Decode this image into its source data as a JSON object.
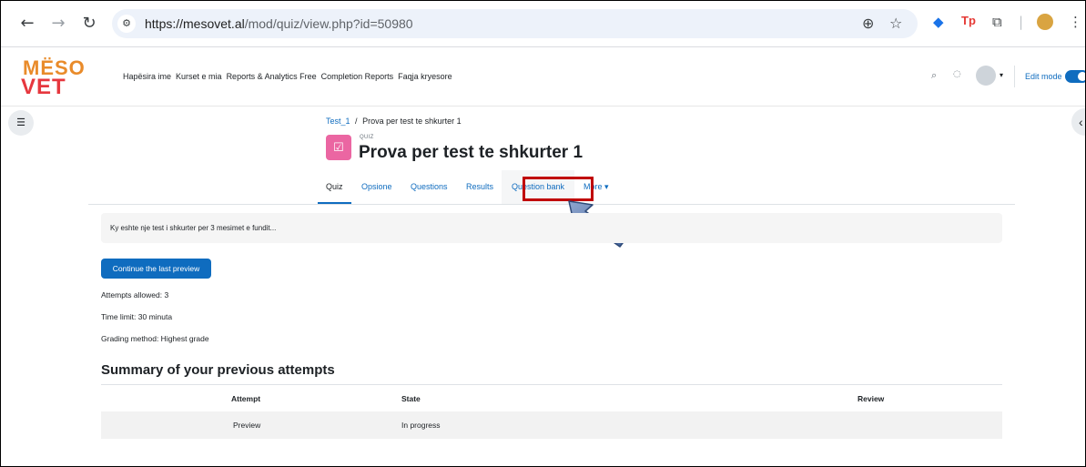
{
  "browser": {
    "url_domain": "https://mesovet.al",
    "url_path": "/mod/quiz/view.php?id=50980",
    "back_icon": "←",
    "forward_icon": "→",
    "reload_icon": "↻",
    "zoom_icon": "⊕",
    "star_icon": "☆",
    "ext_tp": "Tp",
    "menu_icon": "⋮"
  },
  "logo": {
    "line1": "MËSO",
    "line2": "VET"
  },
  "primary_nav": [
    "Hapësira ime",
    "Kurset e mia",
    "Reports & Analytics Free",
    "Completion Reports",
    "Faqja kryesore"
  ],
  "header_right": {
    "edit_mode": "Edit mode"
  },
  "breadcrumb": {
    "course": "Test_1",
    "sep": "/",
    "current": "Prova per test te shkurter 1"
  },
  "activity": {
    "type_label": "QUIZ",
    "title": "Prova per test te shkurter 1"
  },
  "tabs": [
    {
      "label": "Quiz"
    },
    {
      "label": "Opsione"
    },
    {
      "label": "Questions"
    },
    {
      "label": "Results"
    },
    {
      "label": "Question bank"
    },
    {
      "label": "More ▾"
    }
  ],
  "intro_text": "Ky eshte nje test i shkurter per 3 mesimet e fundit...",
  "continue_button": "Continue the last preview",
  "info": {
    "attempts": "Attempts allowed: 3",
    "time_limit": "Time limit: 30 minuta",
    "grading": "Grading method: Highest grade"
  },
  "summary_title": "Summary of your previous attempts",
  "table": {
    "headers": [
      "Attempt",
      "State",
      "Review"
    ],
    "rows": [
      [
        "Preview",
        "In progress",
        ""
      ]
    ]
  },
  "colors": {
    "brand_blue": "#0f6cbf",
    "quiz_pink": "#eb66a2",
    "highlight_red": "#c00000",
    "arrow_blue": "#3f5f96"
  }
}
